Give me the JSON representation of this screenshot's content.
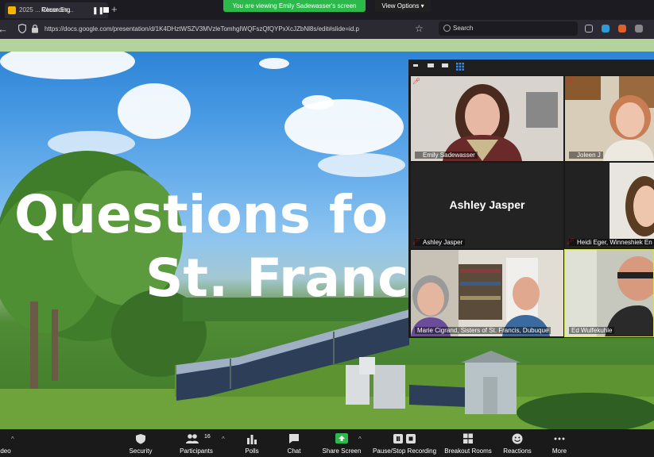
{
  "browser": {
    "tab_title": "2025 ... Clean En...",
    "recording_label": "Recording",
    "url": "https://docs.google.com/presentation/d/1K4DHztWSZV3MVzleTomhgIWQFszQfQYPxXcJZbNl8s/edit#slide=id.p",
    "url_host": "docs.google.com",
    "search_placeholder": "Search"
  },
  "zoom_banner": {
    "viewing_text": "You are viewing Emily Sadewasser's screen",
    "view_options": "View Options"
  },
  "slide": {
    "title_line1": "Questions fo",
    "title_line2": "St. Franc"
  },
  "participants": [
    {
      "name": "Emily Sadewasser"
    },
    {
      "name": "Joleen J"
    },
    {
      "name": "Ashley Jasper"
    },
    {
      "name": "Heidi Eger, Winneshiek En"
    },
    {
      "name": "Marie Cigrand, Sisters of St. Francis, Dubuque"
    },
    {
      "name": "Ed Wulfekuhle"
    }
  ],
  "controls": {
    "video": "deo",
    "security": "Security",
    "participants": "Participants",
    "participant_count": "16",
    "polls": "Polls",
    "chat": "Chat",
    "share_screen": "Share Screen",
    "pause_recording": "Pause/Stop Recording",
    "breakout": "Breakout Rooms",
    "reactions": "Reactions",
    "more": "More"
  },
  "colors": {
    "share_green": "#2db84b",
    "active_speaker": "#d6e35a",
    "muted_red": "#e02828"
  }
}
